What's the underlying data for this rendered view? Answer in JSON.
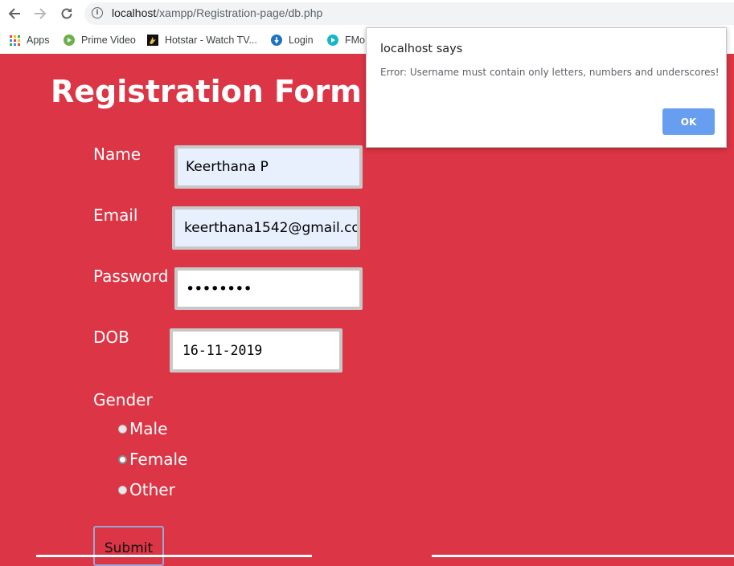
{
  "browser": {
    "url_host": "localhost",
    "url_path": "/xampp/Registration-page/db.php",
    "bookmarks": [
      {
        "label": "Apps",
        "icon": "apps-grid-icon"
      },
      {
        "label": "Prime Video",
        "icon": "prime-video-icon"
      },
      {
        "label": "Hotstar - Watch TV...",
        "icon": "hotstar-icon"
      },
      {
        "label": "Login",
        "icon": "login-icon"
      },
      {
        "label": "FMo",
        "icon": "fmovies-icon"
      }
    ]
  },
  "page": {
    "title": "Registration Form",
    "name_label": "Name",
    "name_value": "Keerthana P",
    "email_label": "Email",
    "email_value": "keerthana1542@gmail.co",
    "password_label": "Password",
    "password_value": "••••••••",
    "dob_label": "DOB",
    "dob_value": "16-11-2019",
    "gender_label": "Gender",
    "gender_options": [
      "Male",
      "Female",
      "Other"
    ],
    "submit_label": "Submit"
  },
  "dialog": {
    "title": "localhost says",
    "message": "Error: Username must contain only letters, numbers and underscores!",
    "ok_label": "OK"
  },
  "colors": {
    "page_background": "#dc3545",
    "dialog_ok_button": "#689ef0"
  }
}
